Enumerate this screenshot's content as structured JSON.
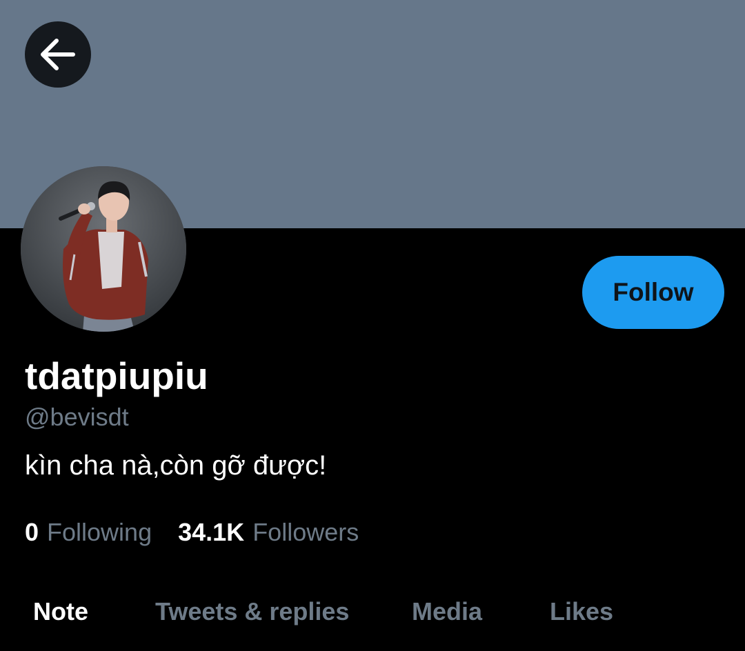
{
  "colors": {
    "banner": "#66778a",
    "background": "#000000",
    "accent": "#1d9bf0",
    "muted_text": "#6e7b88",
    "primary_text": "#ffffff"
  },
  "header": {
    "back_icon": "arrow-left-icon"
  },
  "profile": {
    "avatar": "profile-avatar-photo",
    "follow_label": "Follow",
    "display_name": "tdatpiupiu",
    "handle": "@bevisdt",
    "bio": "kìn cha nà,còn gỡ được!",
    "following_count": "0",
    "following_label": "Following",
    "followers_count": "34.1K",
    "followers_label": "Followers"
  },
  "tabs": [
    {
      "label": "Note",
      "active": true
    },
    {
      "label": "Tweets & replies",
      "active": false
    },
    {
      "label": "Media",
      "active": false
    },
    {
      "label": "Likes",
      "active": false
    }
  ]
}
